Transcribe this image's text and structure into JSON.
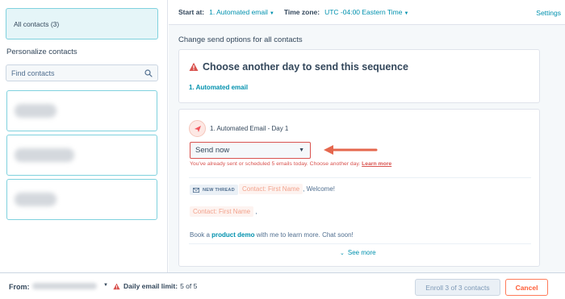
{
  "sidebar": {
    "all_contacts_label": "All contacts (3)",
    "personalize_heading": "Personalize contacts",
    "search_placeholder": "Find contacts"
  },
  "topbar": {
    "start_at_label": "Start at:",
    "start_at_value": "1. Automated email",
    "timezone_label": "Time zone:",
    "timezone_value": "UTC -04:00 Eastern Time",
    "settings_label": "Settings"
  },
  "main": {
    "section_text": "Change send options for all contacts",
    "warning_card": {
      "title": "Choose another day to send this sequence",
      "step_link": "1. Automated email"
    },
    "email_card": {
      "step_title": "1. Automated Email - Day 1",
      "send_select_value": "Send now",
      "error_text": "You've already sent or scheduled 5 emails today. Choose another day.",
      "learn_more": "Learn more",
      "thread_badge": "NEW THREAD",
      "token1": "Contact: First Name",
      "line1_suffix": ", Welcome!",
      "token2": "Contact: First Name",
      "line2_suffix": ",",
      "body_before": "Book a ",
      "body_link": "product demo",
      "body_after": " with me to learn more. Chat soon!",
      "see_more": "See more"
    }
  },
  "footer": {
    "from_label": "From:",
    "limit_label": "Daily email limit:",
    "limit_value": "5 of 5",
    "enroll_button": "Enroll 3 of 3 contacts",
    "cancel_button": "Cancel"
  },
  "colors": {
    "accent_link": "#0091ae",
    "error": "#d9534f",
    "cancel_orange": "#ff5c35",
    "selected_bg": "#e5f5f8"
  },
  "icons": [
    "search-icon",
    "warning-icon",
    "send-icon",
    "envelope-icon",
    "chevron-down-icon",
    "annotation-arrow"
  ]
}
